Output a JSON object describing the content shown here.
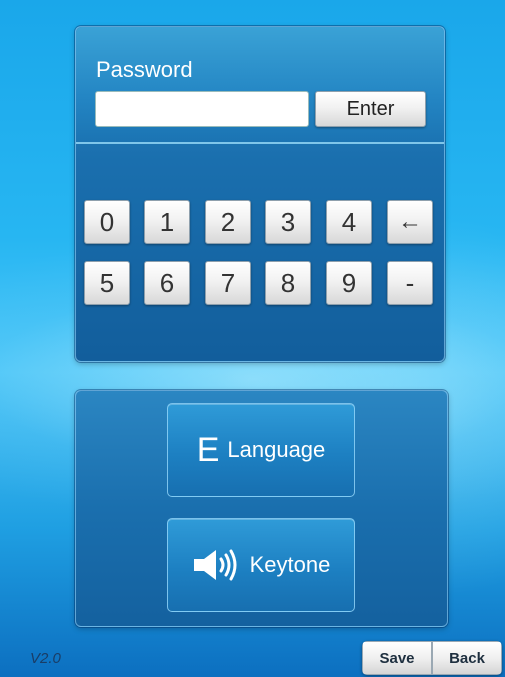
{
  "password": {
    "label": "Password",
    "input_value": "",
    "enter_label": "Enter"
  },
  "keypad": {
    "row1": [
      "0",
      "1",
      "2",
      "3",
      "4",
      "←"
    ],
    "row2": [
      "5",
      "6",
      "7",
      "8",
      "9",
      "-"
    ]
  },
  "settings": {
    "language_icon_text": "E",
    "language_label": "Language",
    "keytone_icon": "speaker-icon",
    "keytone_label": "Keytone"
  },
  "footer": {
    "version": "V2.0",
    "save_label": "Save",
    "back_label": "Back"
  }
}
